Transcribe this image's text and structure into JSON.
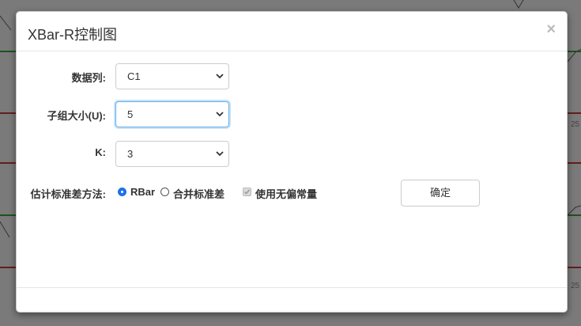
{
  "dialog": {
    "title": "XBar-R控制图",
    "close_label": "×"
  },
  "form": {
    "data_column": {
      "label": "数据列:",
      "value": "C1"
    },
    "subgroup_size": {
      "label": "子组大小(U):",
      "value": "5"
    },
    "k": {
      "label": "K:",
      "value": "3"
    },
    "std_method": {
      "label": "估计标准差方法:",
      "options": [
        {
          "label": "RBar",
          "selected": true
        },
        {
          "label": "合并标准差",
          "selected": false
        }
      ],
      "unbiased": {
        "label": "使用无偏常量",
        "checked": true,
        "disabled": true
      }
    },
    "ok_label": "确定"
  },
  "background": {
    "tick_labels": [
      "25",
      "25"
    ],
    "colors": {
      "limit_line": "#b00000",
      "center_line": "#008800"
    }
  }
}
